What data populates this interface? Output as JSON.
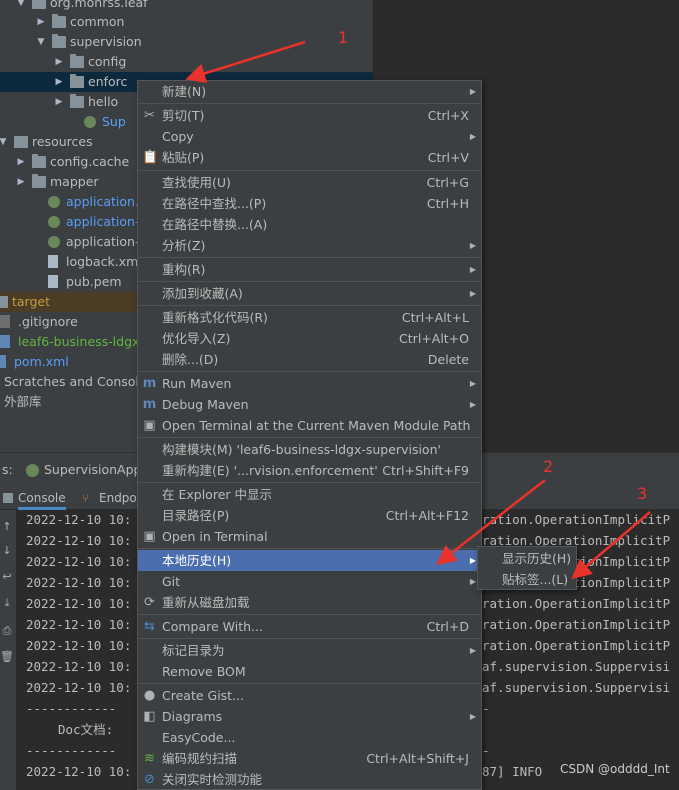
{
  "tree": [
    {
      "label": "org.mohrss.leaf",
      "arrow": "▼",
      "color": "plain"
    },
    {
      "label": "common",
      "arrow": "▶",
      "color": "plain"
    },
    {
      "label": "supervision",
      "arrow": "▼",
      "color": "plain"
    },
    {
      "label": "config",
      "arrow": "▶",
      "color": "plain"
    },
    {
      "label": "enforc",
      "arrow": "▶",
      "color": "plain"
    },
    {
      "label": "hello",
      "arrow": "▶",
      "color": "plain"
    },
    {
      "label": "Sup",
      "arrow": "",
      "color": "blue"
    },
    {
      "label": "resources",
      "arrow": "▼",
      "color": "plain"
    },
    {
      "label": "config.cache",
      "arrow": "▶",
      "color": "plain"
    },
    {
      "label": "mapper",
      "arrow": "▶",
      "color": "plain"
    },
    {
      "label": "application.y",
      "arrow": "",
      "color": "blue"
    },
    {
      "label": "application-",
      "arrow": "",
      "color": "blue"
    },
    {
      "label": "application-",
      "arrow": "",
      "color": "plain"
    },
    {
      "label": "logback.xml",
      "arrow": "",
      "color": "plain"
    },
    {
      "label": "pub.pem",
      "arrow": "",
      "color": "plain"
    },
    {
      "label": "target",
      "arrow": "",
      "color": "orange"
    },
    {
      "label": ".gitignore",
      "arrow": "",
      "color": "plain"
    },
    {
      "label": "leaf6-business-ldgx-s",
      "arrow": "",
      "color": "green"
    },
    {
      "label": "pom.xml",
      "arrow": "",
      "color": "blue"
    },
    {
      "label": "Scratches and Consoles",
      "arrow": "",
      "color": "plain"
    },
    {
      "label": "外部库",
      "arrow": "",
      "color": "plain"
    }
  ],
  "run_header": {
    "prefix": "s:",
    "config_name": "SupervisionApp"
  },
  "console_tabs": {
    "console": "Console",
    "endpoints": "Endpoi"
  },
  "console": {
    "timestamp_prefix": "2022-12-10 10:",
    "right_texts": [
      "ration.OperationImplicitP",
      "ration.OperationImplicitP",
      "ration.OperationImplicitP",
      "ration.OperationImplicitP",
      "ration.OperationImplicitP",
      "ration.OperationImplicitP",
      "ration.OperationImplicitP",
      "af.supervision.Suppervisi",
      "af.supervision.Suppervisi"
    ],
    "divider_left": "------------",
    "doc_label": "Doc文档:",
    "divider_right": "-",
    "last_right": "87] INFO",
    "watermark": "CSDN @odddd_Int"
  },
  "menu": {
    "items": [
      {
        "label": "新建(N)",
        "shortcut": "",
        "submenu": true,
        "icon": ""
      },
      {
        "label": "剪切(T)",
        "shortcut": "Ctrl+X",
        "submenu": false,
        "icon": "✂"
      },
      {
        "label": "Copy",
        "shortcut": "",
        "submenu": true,
        "icon": ""
      },
      {
        "label": "粘贴(P)",
        "shortcut": "Ctrl+V",
        "submenu": false,
        "icon": "📋"
      },
      {
        "label": "查找使用(U)",
        "shortcut": "Ctrl+G",
        "submenu": false,
        "icon": ""
      },
      {
        "label": "在路径中查找...(P)",
        "shortcut": "Ctrl+H",
        "submenu": false,
        "icon": ""
      },
      {
        "label": "在路径中替换...(A)",
        "shortcut": "",
        "submenu": false,
        "icon": ""
      },
      {
        "label": "分析(Z)",
        "shortcut": "",
        "submenu": true,
        "icon": ""
      },
      {
        "label": "重构(R)",
        "shortcut": "",
        "submenu": true,
        "icon": ""
      },
      {
        "label": "添加到收藏(A)",
        "shortcut": "",
        "submenu": true,
        "icon": ""
      },
      {
        "label": "重新格式化代码(R)",
        "shortcut": "Ctrl+Alt+L",
        "submenu": false,
        "icon": ""
      },
      {
        "label": "优化导入(Z)",
        "shortcut": "Ctrl+Alt+O",
        "submenu": false,
        "icon": ""
      },
      {
        "label": "删除...(D)",
        "shortcut": "Delete",
        "submenu": false,
        "icon": ""
      },
      {
        "label": "Run Maven",
        "shortcut": "",
        "submenu": true,
        "icon": "m"
      },
      {
        "label": "Debug Maven",
        "shortcut": "",
        "submenu": true,
        "icon": "m"
      },
      {
        "label": "Open Terminal at the Current Maven Module Path",
        "shortcut": "",
        "submenu": false,
        "icon": "▣"
      },
      {
        "label": "构建模块(M) 'leaf6-business-ldgx-supervision'",
        "shortcut": "",
        "submenu": false,
        "icon": ""
      },
      {
        "label": "重新构建(E) '...rvision.enforcement'",
        "shortcut": "Ctrl+Shift+F9",
        "submenu": false,
        "icon": ""
      },
      {
        "label": "在 Explorer 中显示",
        "shortcut": "",
        "submenu": false,
        "icon": ""
      },
      {
        "label": "目录路径(P)",
        "shortcut": "Ctrl+Alt+F12",
        "submenu": false,
        "icon": ""
      },
      {
        "label": "Open in Terminal",
        "shortcut": "",
        "submenu": false,
        "icon": "▣"
      },
      {
        "label": "本地历史(H)",
        "shortcut": "",
        "submenu": true,
        "icon": ""
      },
      {
        "label": "Git",
        "shortcut": "",
        "submenu": true,
        "icon": ""
      },
      {
        "label": "重新从磁盘加载",
        "shortcut": "",
        "submenu": false,
        "icon": "⟳"
      },
      {
        "label": "Compare With...",
        "shortcut": "Ctrl+D",
        "submenu": false,
        "icon": "⇆"
      },
      {
        "label": "标记目录为",
        "shortcut": "",
        "submenu": true,
        "icon": ""
      },
      {
        "label": "Remove BOM",
        "shortcut": "",
        "submenu": false,
        "icon": ""
      },
      {
        "label": "Create Gist...",
        "shortcut": "",
        "submenu": false,
        "icon": "●"
      },
      {
        "label": "Diagrams",
        "shortcut": "",
        "submenu": true,
        "icon": "◧"
      },
      {
        "label": "EasyCode...",
        "shortcut": "",
        "submenu": false,
        "icon": ""
      },
      {
        "label": "编码规约扫描",
        "shortcut": "Ctrl+Alt+Shift+J",
        "submenu": false,
        "icon": "≋"
      },
      {
        "label": "关闭实时检测功能",
        "shortcut": "",
        "submenu": false,
        "icon": "⊘"
      }
    ]
  },
  "submenu": {
    "items": [
      "显示历史(H)",
      "贴标签...(L)"
    ]
  },
  "annotations": {
    "one": "1",
    "two": "2",
    "three": "3"
  }
}
